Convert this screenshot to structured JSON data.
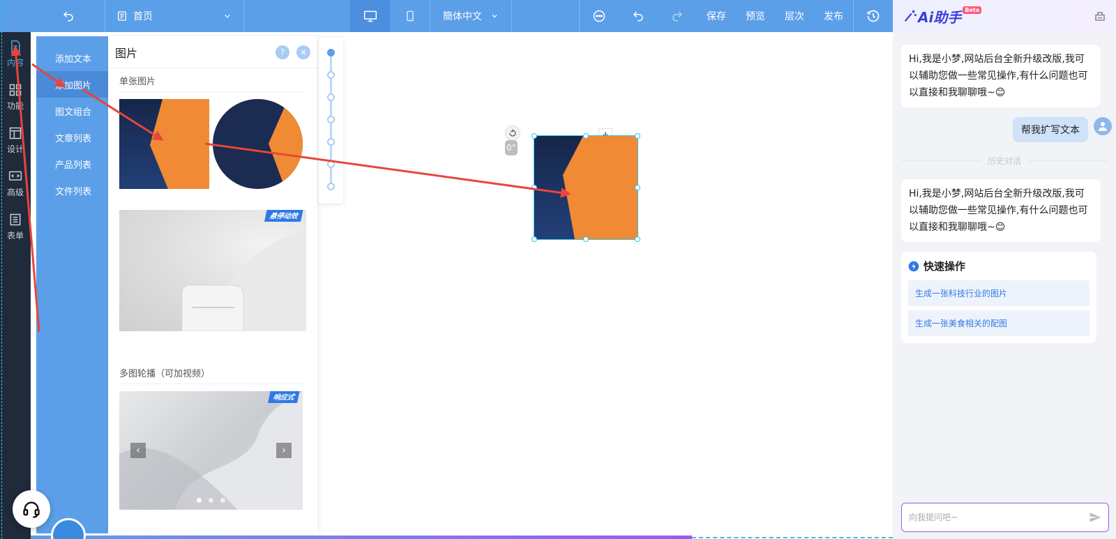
{
  "topbar": {
    "page_label": "首页",
    "language_label": "簡体中文",
    "save_label": "保存",
    "preview_label": "预览",
    "layers_label": "层次",
    "publish_label": "发布"
  },
  "rail": {
    "items": [
      {
        "label": "内容",
        "icon": "document-icon"
      },
      {
        "label": "功能",
        "icon": "grid-icon"
      },
      {
        "label": "设计",
        "icon": "layout-icon"
      },
      {
        "label": "高级",
        "icon": "code-icon"
      },
      {
        "label": "表单",
        "icon": "list-icon"
      }
    ]
  },
  "submenu": {
    "items": [
      "添加文本",
      "添加图片",
      "图文组合",
      "文章列表",
      "产品列表",
      "文件列表"
    ],
    "active_index": 1
  },
  "panel": {
    "title": "图片",
    "help_label": "?",
    "single_section": "单张图片",
    "hover_badge": "悬停动效",
    "carousel_section": "多图轮播（可加视频）",
    "carousel_badge": "响应式"
  },
  "canvas": {
    "rotation_value": "0°"
  },
  "ai": {
    "logo": "Ai助手",
    "beta": "Beta",
    "greeting": "Hi,我是小梦,网站后台全新升级改版,我可以辅助您做一些常见操作,有什么问题也可以直接和我聊聊哦~",
    "emoji": "😊",
    "user_message": "帮我扩写文本",
    "history_label": "历史对话",
    "quick_title": "快速操作",
    "quick_actions": [
      "生成一张科技行业的图片",
      "生成一张美食相关的配图"
    ],
    "input_placeholder": "向我提问吧~"
  },
  "colors": {
    "toolbar": "#5b9fe8",
    "rail": "#1f2a3a",
    "selection": "#33c2ea",
    "accent": "#2f79e6",
    "ai_border": "#9b5bf0",
    "arrow": "#e8453c",
    "tile_navy": "#1b2f59",
    "tile_orange": "#f08a35"
  }
}
